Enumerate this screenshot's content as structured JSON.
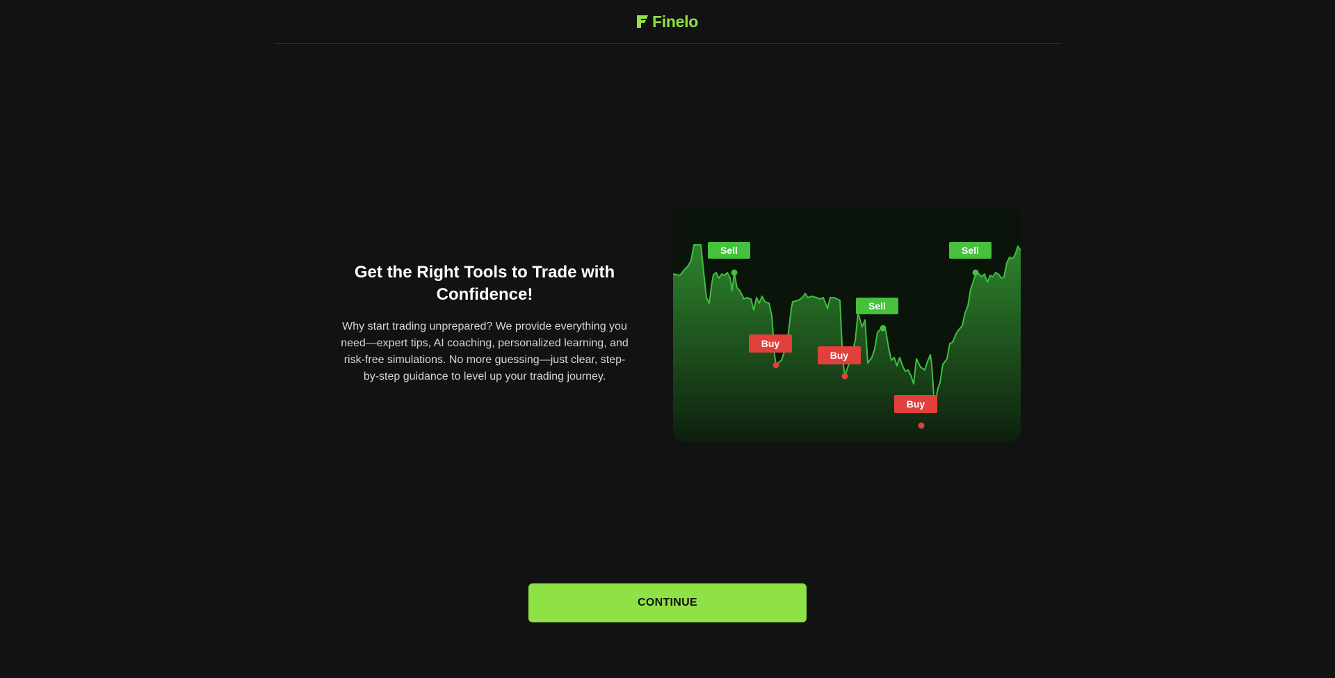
{
  "brand": {
    "name": "Finelo",
    "color": "#8fe245"
  },
  "hero": {
    "title": "Get the Right Tools to Trade with Confidence!",
    "body": "Why start trading unprepared? We provide everything you need—expert tips, AI coaching, personalized learning, and risk-free simulations. No more guessing—just clear, step-by-step guidance to level up your trading journey."
  },
  "chart": {
    "line_color": "#3fbf3f",
    "fill_top": "#2f8a2f",
    "fill_bottom": "#0d1f0d",
    "sell_color": "#45c13d",
    "buy_color": "#e2403c",
    "markers": [
      {
        "type": "sell",
        "label": "Sell"
      },
      {
        "type": "buy",
        "label": "Buy"
      },
      {
        "type": "buy",
        "label": "Buy"
      },
      {
        "type": "sell",
        "label": "Sell"
      },
      {
        "type": "buy",
        "label": "Buy"
      },
      {
        "type": "sell",
        "label": "Sell"
      }
    ]
  },
  "actions": {
    "continue_label": "CONTINUE"
  }
}
